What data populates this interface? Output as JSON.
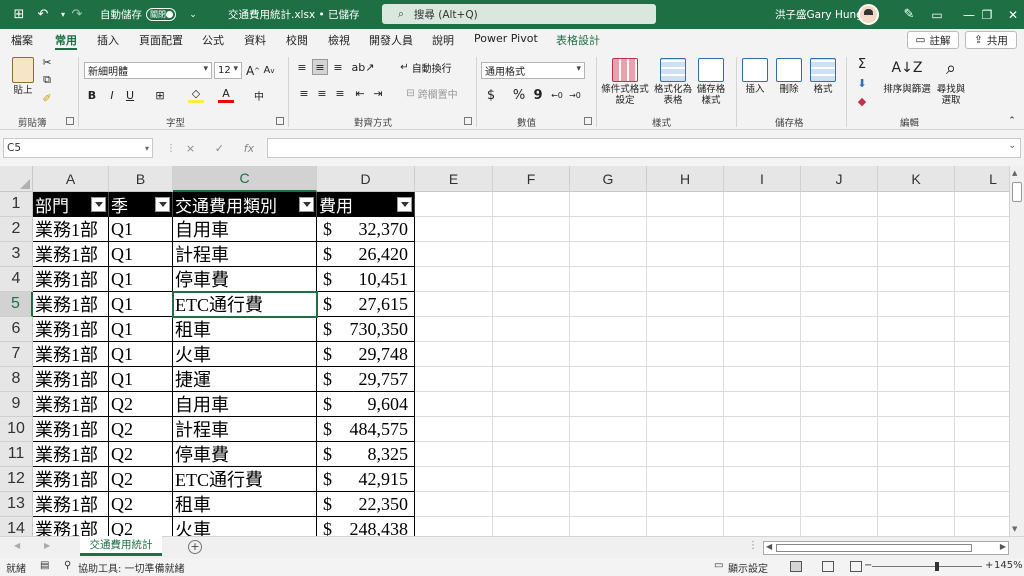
{
  "titlebar": {
    "autosave_label": "自動儲存",
    "autosave_state": "關閉",
    "filename": "交通費用統計.xlsx • 已儲存",
    "search_placeholder": "搜尋 (Alt+Q)",
    "username": "洪子盛Gary Hung"
  },
  "ribbon_tabs": [
    "檔案",
    "常用",
    "插入",
    "頁面配置",
    "公式",
    "資料",
    "校閱",
    "檢視",
    "開發人員",
    "說明",
    "Power Pivot",
    "表格設計"
  ],
  "active_tab": "常用",
  "ribbon_actions": {
    "comment": "註解",
    "share": "共用"
  },
  "ribbon": {
    "clipboard": {
      "label": "剪貼簿",
      "paste": "貼上"
    },
    "font": {
      "label": "字型",
      "name": "新細明體",
      "size": "12",
      "grow": "A",
      "shrink": "A",
      "bold": "B",
      "italic": "I",
      "underline": "U"
    },
    "alignment": {
      "label": "對齊方式",
      "wrap": "自動換行",
      "merge": "跨欄置中"
    },
    "number": {
      "label": "數值",
      "format": "通用格式",
      "currency": "$",
      "percent": "%",
      "comma": "9"
    },
    "styles": {
      "label": "樣式",
      "conditional": "條件式格式\n設定",
      "as_table": "格式化為\n表格",
      "cell_styles": "儲存格\n樣式"
    },
    "cells": {
      "label": "儲存格",
      "insert": "插入",
      "delete": "刪除",
      "format": "格式"
    },
    "editing": {
      "label": "編輯",
      "sort_filter": "排序與篩選",
      "find_select": "尋找與\n選取"
    }
  },
  "formula_bar": {
    "name_box": "C5",
    "cancel": "×",
    "enter": "✓",
    "fx": "fx",
    "formula": ""
  },
  "columns": [
    "A",
    "B",
    "C",
    "D",
    "E",
    "F",
    "G",
    "H",
    "I",
    "J",
    "K",
    "L"
  ],
  "row_numbers": [
    "1",
    "2",
    "3",
    "4",
    "5",
    "6",
    "7",
    "8",
    "9",
    "10",
    "11",
    "12",
    "13",
    "14"
  ],
  "table": {
    "headers": [
      "部門",
      "季",
      "交通費用類別",
      "費用"
    ],
    "rows": [
      [
        "業務1部",
        "Q1",
        "自用車",
        "32,370"
      ],
      [
        "業務1部",
        "Q1",
        "計程車",
        "26,420"
      ],
      [
        "業務1部",
        "Q1",
        "停車費",
        "10,451"
      ],
      [
        "業務1部",
        "Q1",
        "ETC通行費",
        "27,615"
      ],
      [
        "業務1部",
        "Q1",
        "租車",
        "730,350"
      ],
      [
        "業務1部",
        "Q1",
        "火車",
        "29,748"
      ],
      [
        "業務1部",
        "Q1",
        "捷運",
        "29,757"
      ],
      [
        "業務1部",
        "Q2",
        "自用車",
        "9,604"
      ],
      [
        "業務1部",
        "Q2",
        "計程車",
        "484,575"
      ],
      [
        "業務1部",
        "Q2",
        "停車費",
        "8,325"
      ],
      [
        "業務1部",
        "Q2",
        "ETC通行費",
        "42,915"
      ],
      [
        "業務1部",
        "Q2",
        "租車",
        "22,350"
      ],
      [
        "業務1部",
        "Q2",
        "火車",
        "248,438"
      ]
    ],
    "currency_symbol": "$"
  },
  "sheet_tabs": [
    "交通費用統計"
  ],
  "statusbar": {
    "ready": "就緒",
    "accessibility": "協助工具: 一切準備就緒",
    "display_settings": "顯示設定",
    "zoom": "145%"
  },
  "colors": {
    "accent": "#1e6f43",
    "header_bg": "#000000"
  }
}
